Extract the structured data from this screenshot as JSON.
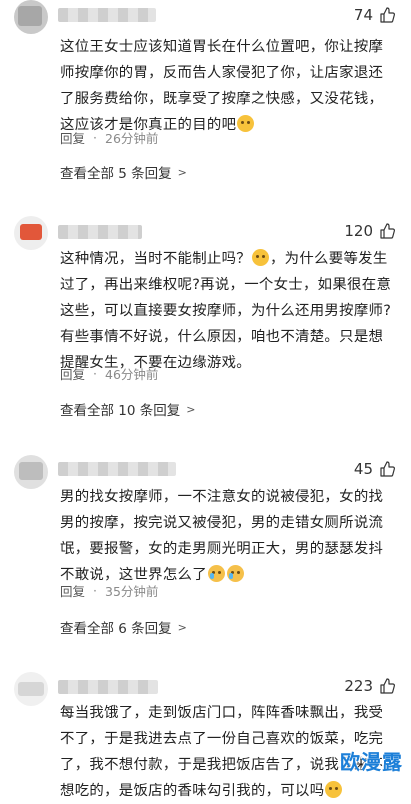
{
  "comments": [
    {
      "likes": "74",
      "text": "这位王女士应该知道胃长在什么位置吧，你让按摩师按摩你的胃，反而告人家侵犯了你，让店家退还了服务费给你，既享受了按摩之快感，又没花钱，这应该才是你真正的目的吧",
      "emoji": "smile-emoji",
      "reply_label": "回复",
      "time": "26分钟前",
      "more_label": "查看全部 5 条回复"
    },
    {
      "likes": "120",
      "text_part1": "这种情况，当时不能制止吗？",
      "text_part2": "，为什么要等发生过了，再出来维权呢?再说，一个女士，如果很在意这些，可以直接要女按摩师，为什么还用男按摩师?有些事情不好说，什么原因，咱也不清楚。只是想提醒女生，不要在边缘游戏。",
      "reply_label": "回复",
      "time": "46分钟前",
      "more_label": "查看全部 10 条回复"
    },
    {
      "likes": "45",
      "text": "男的找女按摩师，一不注意女的说被侵犯，女的找男的按摩，按完说又被侵犯，男的走错女厕所说流氓，要报警，女的走男厕光明正大，男的瑟瑟发抖不敢说，这世界怎么了",
      "reply_label": "回复",
      "time": "35分钟前",
      "more_label": "查看全部 6 条回复"
    },
    {
      "likes": "223",
      "text": "每当我饿了，走到饭店门口，阵阵香味飘出，我受不了，于是我进去点了一份自己喜欢的饭菜，吃完了，我不想付款，于是我把饭店告了，说我本来不想吃的，是饭店的香味勾引我的，可以吗"
    }
  ],
  "watermark": "欧漫露"
}
